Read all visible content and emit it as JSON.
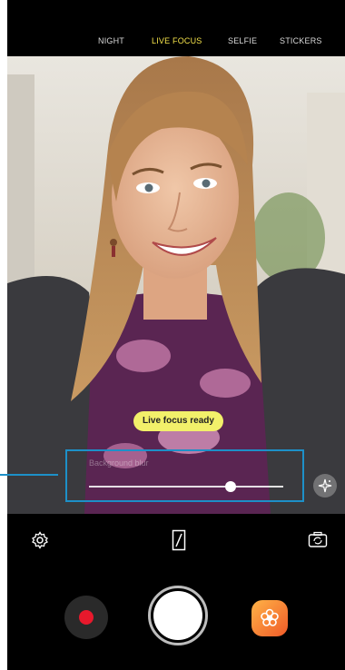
{
  "modes": [
    "NIGHT",
    "LIVE FOCUS",
    "SELFIE",
    "STICKERS"
  ],
  "active_mode": "LIVE FOCUS",
  "viewfinder": {
    "badge": "Live focus ready",
    "blur_label": "Background blur",
    "blur_level": 0.73
  },
  "icons": {
    "settings": "gear-icon",
    "ratio": "aspect-ratio-icon",
    "switch_camera": "switch-camera-icon",
    "effects": "sparkle-icon",
    "stickers": "flower-icon"
  },
  "colors": {
    "accent": "#f4e24a",
    "callout": "#1d90c8",
    "record": "#e8192c",
    "stickers_gradient_start": "#ffb347",
    "stickers_gradient_end": "#f05a28"
  }
}
